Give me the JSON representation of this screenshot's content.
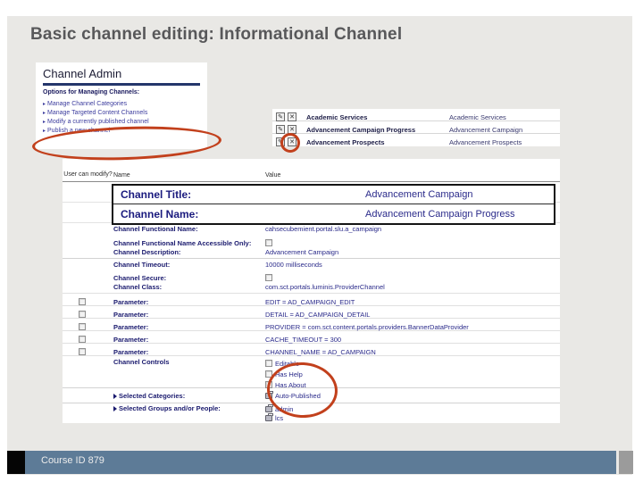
{
  "slide": {
    "title": "Basic channel editing: Informational Channel",
    "footer": "Course ID 879"
  },
  "icons": {
    "edit": "✎",
    "delete": "✕"
  },
  "admin_box": {
    "title": "Channel Admin",
    "subtitle": "Options for Managing Channels:",
    "items": [
      "Manage Channel Categories",
      "Manage Targeted Content Channels",
      "Modify a currently published channel",
      "Publish a new channel"
    ]
  },
  "channel_list": {
    "rows": [
      {
        "name": "Academic Services",
        "value": "Academic Services"
      },
      {
        "name": "Advancement Campaign Progress",
        "value": "Advancement Campaign"
      },
      {
        "name": "Advancement Prospects",
        "value": "Advancement Prospects"
      }
    ]
  },
  "callout": {
    "title_label": "Channel Title:",
    "title_value": "Advancement Campaign",
    "name_label": "Channel Name:",
    "name_value": "Advancement Campaign Progress"
  },
  "main_table": {
    "headers": {
      "modify": "User can modify?",
      "name": "Name",
      "value": "Value"
    },
    "fields": [
      {
        "name": "Channel Functional Name:",
        "value": "cahsecubemient.portal.slu.a_campaign"
      },
      {
        "name": "Channel Functional Name Accessible Only:",
        "value": ""
      },
      {
        "name": "Channel Description:",
        "value": "Advancement Campaign"
      },
      {
        "name": "Channel Timeout:",
        "value": "10000 milliseconds"
      },
      {
        "name": "Channel Secure:",
        "value": ""
      },
      {
        "name": "Channel Class:",
        "value": "com.sct.portals.luminis.ProviderChannel"
      }
    ],
    "parameters": [
      {
        "name": "Parameter:",
        "value": "EDIT = AD_CAMPAIGN_EDIT"
      },
      {
        "name": "Parameter:",
        "value": "DETAIL = AD_CAMPAIGN_DETAIL"
      },
      {
        "name": "Parameter:",
        "value": "PROVIDER = com.sct.content.portals.providers.BannerDataProvider"
      },
      {
        "name": "Parameter:",
        "value": "CACHE_TIMEOUT = 300"
      },
      {
        "name": "Parameter:",
        "value": "CHANNEL_NAME = AD_CAMPAIGN"
      }
    ],
    "controls": {
      "name": "Channel Controls",
      "options": [
        "Editable",
        "Has Help",
        "Has About"
      ]
    },
    "categories": {
      "name": "Selected Categories:",
      "items": [
        "Auto-Published"
      ]
    },
    "groups": {
      "name": "Selected Groups and/or People:",
      "items": [
        "admin",
        "lcs"
      ]
    }
  }
}
